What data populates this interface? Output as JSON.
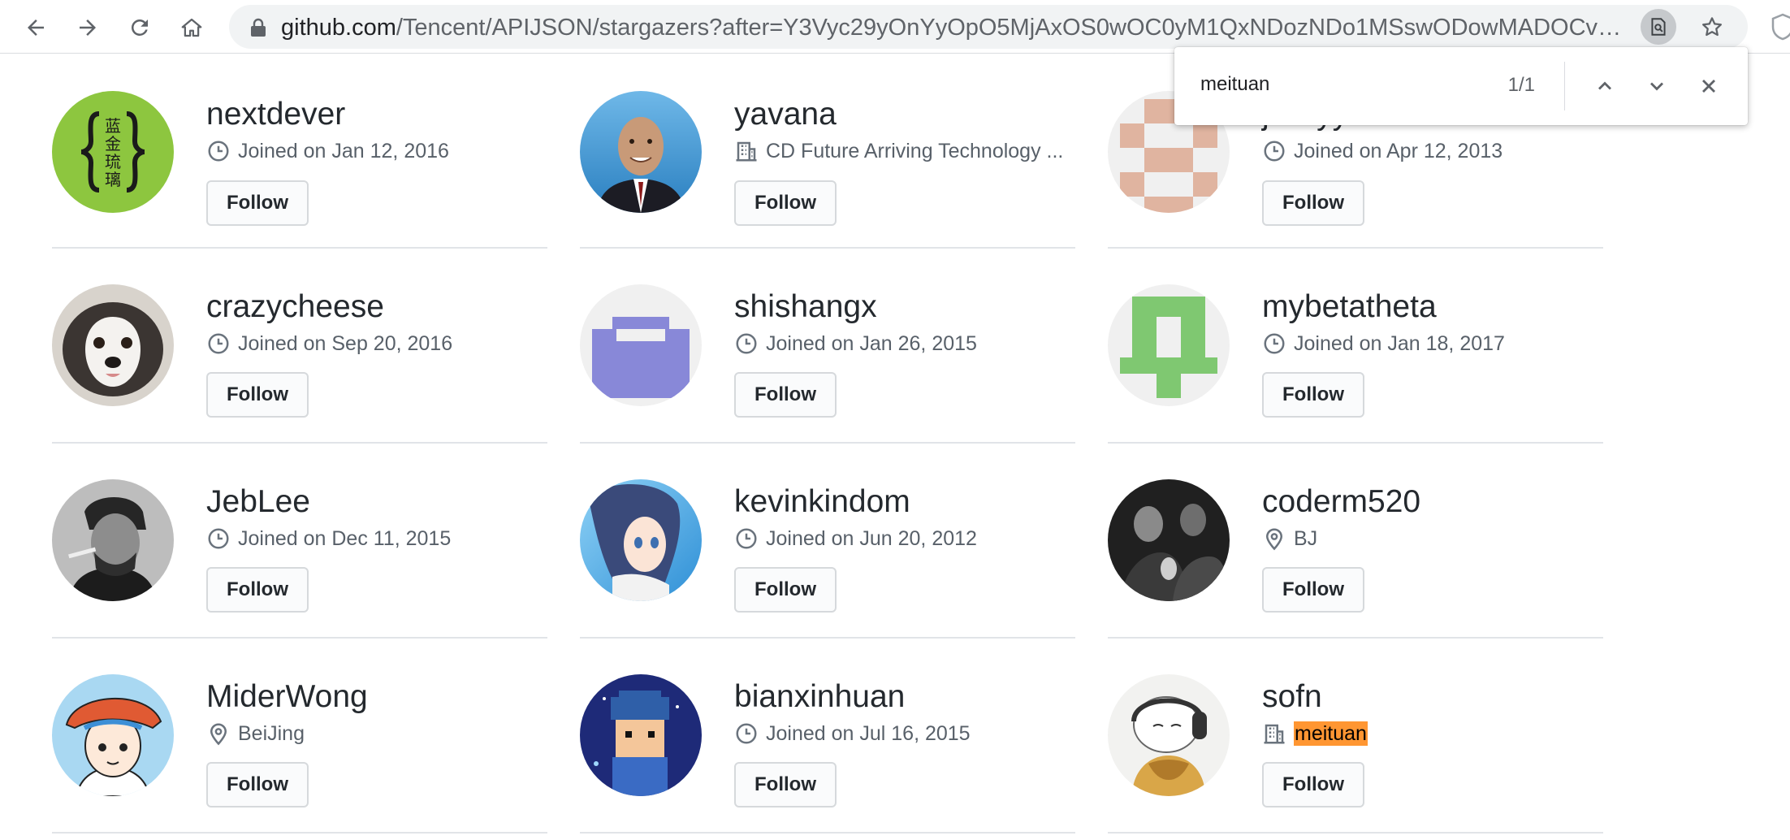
{
  "browser": {
    "url_host": "github.com",
    "url_path": "/Tencent/APIJSON/stargazers?after=Y3Vyc29yOnYyOpO5MjAxOS0wOC0yM1QxNDozNDo1MSswODowMADOCvA..."
  },
  "find_bar": {
    "query": "meituan",
    "count": "1/1"
  },
  "follow_label": "Follow",
  "users": [
    {
      "name": "nextdever",
      "meta_type": "clock",
      "meta": "Joined on Jan 12, 2016"
    },
    {
      "name": "yavana",
      "meta_type": "org",
      "meta": "CD Future Arriving Technology ..."
    },
    {
      "name": "jxxxyy",
      "meta_type": "clock",
      "meta": "Joined on Apr 12, 2013"
    },
    {
      "name": "crazycheese",
      "meta_type": "clock",
      "meta": "Joined on Sep 20, 2016"
    },
    {
      "name": "shishangx",
      "meta_type": "clock",
      "meta": "Joined on Jan 26, 2015"
    },
    {
      "name": "mybetatheta",
      "meta_type": "clock",
      "meta": "Joined on Jan 18, 2017"
    },
    {
      "name": "JebLee",
      "meta_type": "clock",
      "meta": "Joined on Dec 11, 2015"
    },
    {
      "name": "kevinkindom",
      "meta_type": "clock",
      "meta": "Joined on Jun 20, 2012"
    },
    {
      "name": "coderm520",
      "meta_type": "location",
      "meta": "BJ"
    },
    {
      "name": "MiderWong",
      "meta_type": "location",
      "meta": "BeiJing"
    },
    {
      "name": "bianxinhuan",
      "meta_type": "clock",
      "meta": "Joined on Jul 16, 2015"
    },
    {
      "name": "sofn",
      "meta_type": "org",
      "meta": "meituan"
    }
  ],
  "avatar_text": {
    "nextdever": [
      "蓝",
      "金",
      "琉",
      "璃"
    ]
  }
}
